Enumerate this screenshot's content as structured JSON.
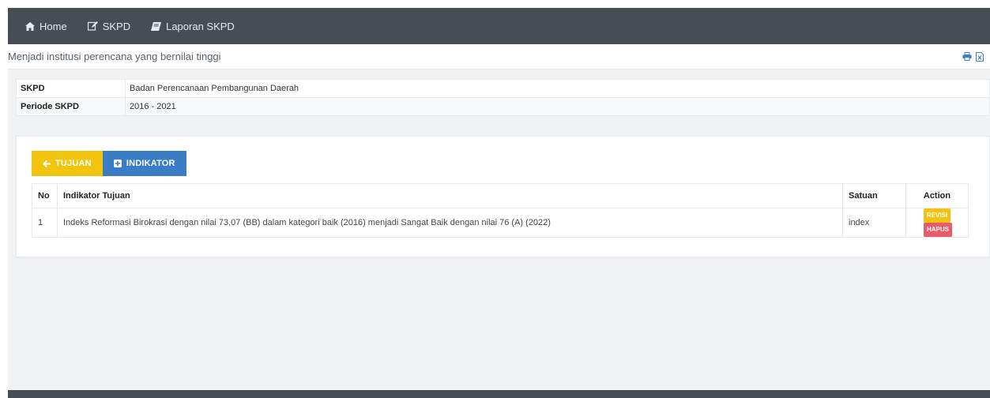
{
  "nav": {
    "items": [
      {
        "label": "Home",
        "icon": "home-icon"
      },
      {
        "label": "SKPD",
        "icon": "edit-icon"
      },
      {
        "label": "Laporan SKPD",
        "icon": "book-icon"
      }
    ]
  },
  "page": {
    "title": "Menjadi institusi perencana yang bernilai tinggi",
    "tools": [
      "print-icon",
      "excel-icon"
    ]
  },
  "info": {
    "rows": [
      {
        "label": "SKPD",
        "value": "Badan Perencanaan Pembangunan Daerah"
      },
      {
        "label": "Periode SKPD",
        "value": "2016 - 2021"
      }
    ]
  },
  "actions": {
    "back_label": "TUJUAN",
    "add_label": "INDIKATOR"
  },
  "table": {
    "headers": {
      "no": "No",
      "indikator": "Indikator Tujuan",
      "satuan": "Satuan",
      "action": "Action"
    },
    "rows": [
      {
        "no": "1",
        "indikator": "Indeks Reformasi Birokrasi dengan nilai 73,07 (BB) dalam kategori baik (2016) menjadi Sangat Baik dengan nilai 76 (A) (2022)",
        "satuan": "index",
        "revisi": "REVISI",
        "hapus": "HAPUS"
      }
    ]
  },
  "colors": {
    "navbar": "#474c55",
    "yellow": "#f1c40f",
    "blue": "#3a7dc5",
    "red": "#e95b6b"
  }
}
